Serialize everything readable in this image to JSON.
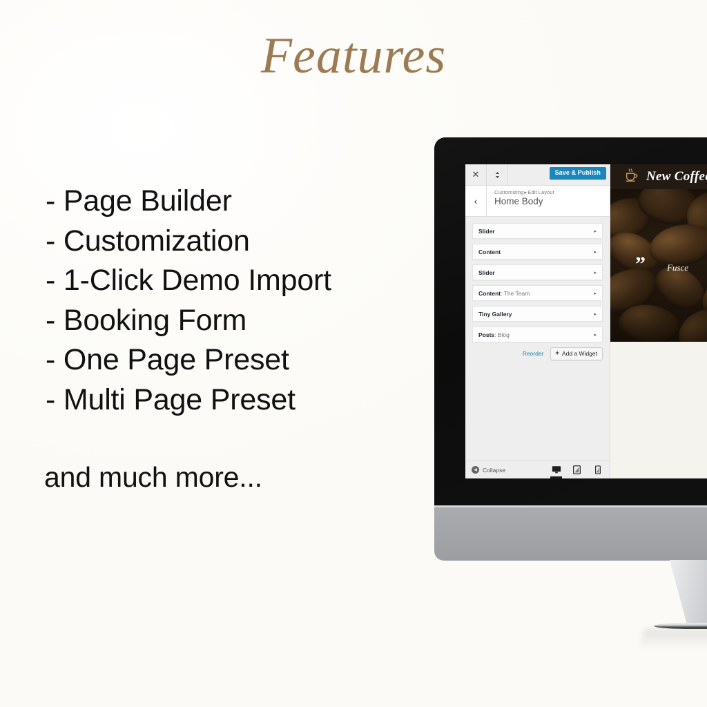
{
  "slide": {
    "title": "Features",
    "title_color": "#9c7b52",
    "background_color": "#fdfcfa",
    "features": [
      "- Page Builder",
      "- Customization",
      "- 1-Click Demo Import",
      "- Booking Form",
      "- One Page Preset",
      "- Multi Page Preset"
    ],
    "closing_text": "and much more..."
  },
  "monitor": {
    "bezel_color": "#111111",
    "chin_color": "#a4a6aa"
  },
  "customizer": {
    "topbar": {
      "close_icon": "close-icon",
      "close_glyph": "✕",
      "collapse_sections_icon": "sort-chevrons-icon",
      "collapse_sections_glyph": "⌄",
      "save_button_label": "Save & Publish",
      "save_button_color": "#1b86bb"
    },
    "header": {
      "back_glyph": "‹",
      "breadcrumb_root": "Customizing",
      "breadcrumb_separator": "▸",
      "breadcrumb_section": "Edit Layout",
      "panel_title": "Home Body"
    },
    "widgets": [
      {
        "name": "Slider",
        "detail": "",
        "arrow": "▸"
      },
      {
        "name": "Content",
        "detail": "",
        "arrow": "▸"
      },
      {
        "name": "Slider",
        "detail": "",
        "arrow": "▸"
      },
      {
        "name": "Content",
        "detail": ": The Team",
        "arrow": "▸"
      },
      {
        "name": "Tiny Gallery",
        "detail": "",
        "arrow": "▸"
      },
      {
        "name": "Posts",
        "detail": ": Blog",
        "arrow": "▸"
      }
    ],
    "actions": {
      "reorder_label": "Reorder",
      "reorder_color": "#1b86bb",
      "add_widget_plus": "+",
      "add_widget_label": "Add a Widget"
    },
    "footer": {
      "collapse_glyph": "◀",
      "collapse_label": "Collapse",
      "devices": [
        {
          "name": "desktop",
          "active": true
        },
        {
          "name": "tablet",
          "active": false
        },
        {
          "name": "mobile",
          "active": false
        }
      ]
    }
  },
  "preview": {
    "site_logo_icon": "coffee-cup-icon",
    "site_name": "New Coffee",
    "hero_quote_mark": "”",
    "hero_quote_text": "Fusce",
    "header_bg": "#231a13",
    "body_bg": "#f5f3ee"
  }
}
